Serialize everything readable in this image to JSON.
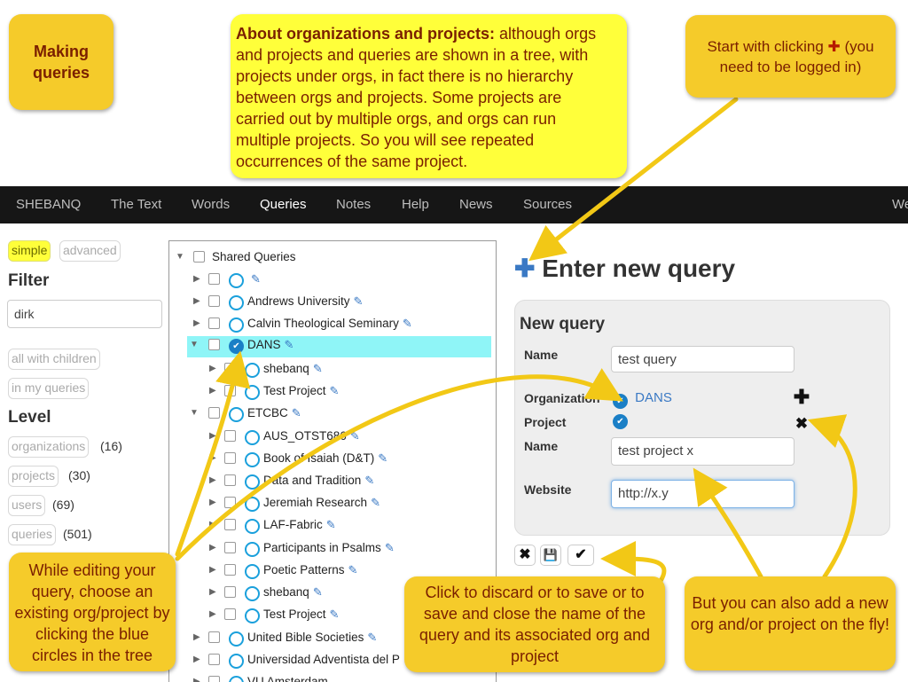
{
  "notes": {
    "making_queries": "Making queries",
    "about_title": "About organizations and projects:",
    "about_body": " although orgs and projects and queries are shown in a tree, with projects under orgs, in fact there is no hierarchy between orgs and projects. Some projects are carried out by multiple orgs, and orgs can run multiple projects. So you will see repeated occurrences of the same project.",
    "start_a": "Start with clicking ",
    "start_plus": "✚",
    "start_b": " (you need to be logged in)",
    "while_editing": "While editing your query, choose an existing org/project by clicking the blue circles in the tree",
    "click_discard": "Click to discard or to save or to save and close the name of the query and its associated org and project",
    "but_also": "But you can also add a new org and/or project on the fly!"
  },
  "nav": {
    "items": [
      "SHEBANQ",
      "The Text",
      "Words",
      "Queries",
      "Notes",
      "Help",
      "News",
      "Sources"
    ],
    "cut_off": "We"
  },
  "sidebar": {
    "mode_simple": "simple",
    "mode_advanced": "advanced",
    "filter_heading": "Filter",
    "filter_value": "dirk",
    "all_with_children": "all with children",
    "in_my_queries": "in my queries",
    "level_heading": "Level",
    "levels": [
      {
        "label": "organizations",
        "count": "(16)"
      },
      {
        "label": "projects",
        "count": "(30)"
      },
      {
        "label": "users",
        "count": "(69)"
      },
      {
        "label": "queries",
        "count": "(501)"
      }
    ]
  },
  "tree": {
    "root": "Shared Queries",
    "orgs": [
      "",
      "Andrews University",
      "Calvin Theological Seminary"
    ],
    "dans": "DANS",
    "dans_children": [
      "shebanq",
      "Test Project"
    ],
    "etcbc": "ETCBC",
    "etcbc_children": [
      "AUS_OTST686",
      "Book of Isaiah (D&T)",
      "Data and Tradition",
      "Jeremiah Research",
      "LAF-Fabric",
      "Participants in Psalms",
      "Poetic Patterns",
      "shebanq",
      "Test Project"
    ],
    "more_orgs": [
      "United Bible Societies",
      "Universidad Adventista del P",
      "VU Amsterdam"
    ]
  },
  "form": {
    "plus": "✚",
    "title": "Enter new query",
    "box_heading": "New query",
    "name_label": "Name",
    "name_value": "test query",
    "org_label": "Organization",
    "org_value": "DANS",
    "project_label": "Project",
    "pname_label": "Name",
    "pname_value": "test project x",
    "website_label": "Website",
    "website_value": "http://x.y",
    "add_glyph": "✚",
    "remove_glyph": "✖",
    "discard_glyph": "✖",
    "save_glyph": "💾",
    "saveclose_glyph": "✔"
  },
  "colors": {
    "note_yellow": "#ffff3a",
    "note_gold": "#f5cb2a",
    "arrow": "#f2c816",
    "navbar": "#161616",
    "selected_row": "#8ff5f7",
    "accent_blue": "#3a79c4"
  }
}
